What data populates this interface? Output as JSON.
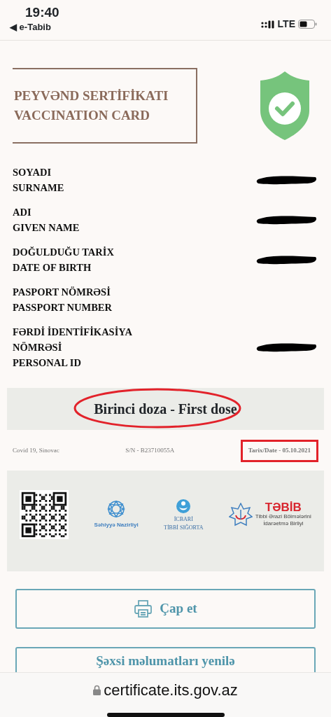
{
  "status_bar": {
    "time": "19:40",
    "back_label": "◀ e-Tabib",
    "network": "LTE"
  },
  "title_lines": [
    "PEYVƏND SERTİFİKATI",
    "VACCINATION CARD"
  ],
  "fields": [
    {
      "label_az": "SOYADI",
      "label_en": "SURNAME",
      "redacted": true
    },
    {
      "label_az": "ADI",
      "label_en": "GIVEN NAME",
      "redacted": true
    },
    {
      "label_az": "DOĞULDUĞU TARİX",
      "label_en": "DATE OF BIRTH",
      "redacted": true
    },
    {
      "label_az": "PASPORT NÖMRƏSİ",
      "label_en": "PASSPORT NUMBER",
      "redacted": false
    },
    {
      "label_az": "FƏRDİ İDENTİFİKASİYA NÖMRƏSİ",
      "label_en": "PERSONAL ID",
      "redacted": true
    }
  ],
  "dose": {
    "text": "Birinci doza - First dose",
    "circled": true
  },
  "info": {
    "vaccine": "Covid 19, Sinovac",
    "serial": "S/N - B23710055A",
    "date": "Tarix/Date - 05.10.2021",
    "date_boxed": true
  },
  "logos": [
    {
      "kind": "qr"
    },
    {
      "kind": "ministry",
      "lines": [
        "Səhiyyə Nazirliyi"
      ]
    },
    {
      "kind": "insurance",
      "lines": [
        "İCBARİ",
        "TİBBİ SIĞORTA"
      ]
    },
    {
      "kind": "tabib",
      "lines": [
        "TƏBİB",
        "Tibbi Ərazi Bölmələrini",
        "İdarəetmə Birliyi"
      ]
    }
  ],
  "buttons": [
    {
      "label": "Çap et"
    },
    {
      "label": "Şəxsi məlumatları yenilə"
    }
  ],
  "address_bar": {
    "url": "certificate.its.gov.az",
    "secure": true
  }
}
